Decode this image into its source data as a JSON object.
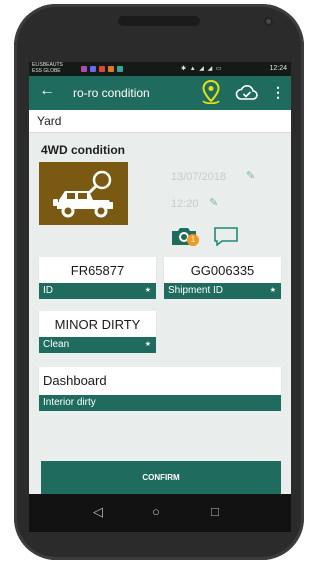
{
  "status_bar": {
    "carrier": "ELISBEAUTS ESS GLOBE",
    "system_icons": "✱ ▲ ◢ ◢ ▭",
    "time": "12:24"
  },
  "app_bar": {
    "back_icon": "arrow-left",
    "title": "ro-ro condition",
    "location_icon": "map-pin",
    "cloud_icon": "cloud-check",
    "menu_icon": "more-vertical"
  },
  "yard": {
    "label": "Yard"
  },
  "section": {
    "title": "4WD condition"
  },
  "car_tile": {
    "color": "#7a5a12",
    "icon": "jeep-with-search"
  },
  "meta": {
    "date": "13/07/2018",
    "time": "12:20"
  },
  "photos": {
    "count": "1"
  },
  "fields": {
    "id": {
      "value": "FR65877",
      "label": "ID"
    },
    "shipment": {
      "value": "GG006335",
      "label": "Shipment ID"
    },
    "clean": {
      "value": "MINOR DIRTY",
      "label": "Clean"
    },
    "interior": {
      "value": "Dashboard",
      "label": "Interior dirty"
    }
  },
  "confirm": {
    "label": "CONFIRM"
  },
  "nav": {
    "back": "◁",
    "home": "○",
    "recents": "□"
  },
  "colors": {
    "primary": "#1f6b5d",
    "accent": "#f39a1e",
    "pin": "#e4e01a"
  }
}
